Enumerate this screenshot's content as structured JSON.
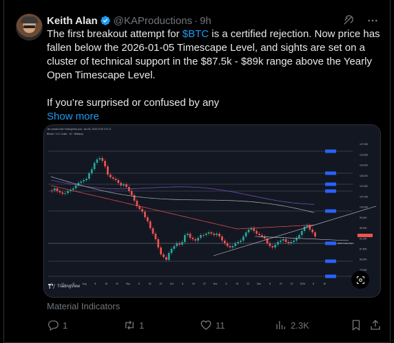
{
  "tweet": {
    "author_name": "Keith Alan",
    "handle": "@KAProductions",
    "separator": "·",
    "time": "9h",
    "text_before_link": "The first breakout attempt for ",
    "cashtag": "$BTC",
    "text_after_link": " is a certified rejection. Now price has fallen below the 2026-01-05 Timescape Level, and sights are set on a cluster of technical support in the $87.5k - $89k range above the Yearly Open Timescape Level.",
    "text_second": "If you’re surprised or confused by any",
    "show_more": "Show more",
    "source_caption": "Material Indicators"
  },
  "media": {
    "watermark": "TradingView",
    "header_line": "Jim created with TradingView.com, Jan 08, 2026 07:52 UTC-5",
    "symbol_line": "Bitcoin / U.S. Dollar · 1D · Bitstamp",
    "price_labels": [
      "127,000",
      "123,500",
      "119,000",
      "115,000",
      "111,500",
      "107,000",
      "103,000",
      "99,000",
      "95,000",
      "91,000",
      "87,500",
      "83,000",
      "79,000",
      "75,000"
    ],
    "level_label": "2026 Yearly Open",
    "date_labels": [
      "8",
      "15",
      "22",
      "Aug",
      "8",
      "15",
      "22",
      "Sep",
      "8",
      "15",
      "22",
      "Oct",
      "8",
      "15",
      "22",
      "Nov",
      "8",
      "15",
      "22",
      "Dec",
      "8",
      "15",
      "22",
      "2026",
      "8",
      "15"
    ]
  },
  "actions": {
    "replies": "1",
    "reposts": "1",
    "likes": "11",
    "views": "2.3K"
  },
  "colors": {
    "link": "#1d9bf0",
    "verified": "#1d9bf0",
    "muted": "#71767b",
    "up_candle": "#26a69a",
    "down_candle": "#ef5350"
  },
  "icons": {
    "verified": "verified-badge-icon",
    "grok": "grok-icon",
    "more": "more-icon",
    "reply": "reply-icon",
    "repost": "repost-icon",
    "like": "heart-icon",
    "views": "views-icon",
    "bookmark": "bookmark-icon",
    "share": "share-icon",
    "image_describe": "image-describe-icon"
  }
}
